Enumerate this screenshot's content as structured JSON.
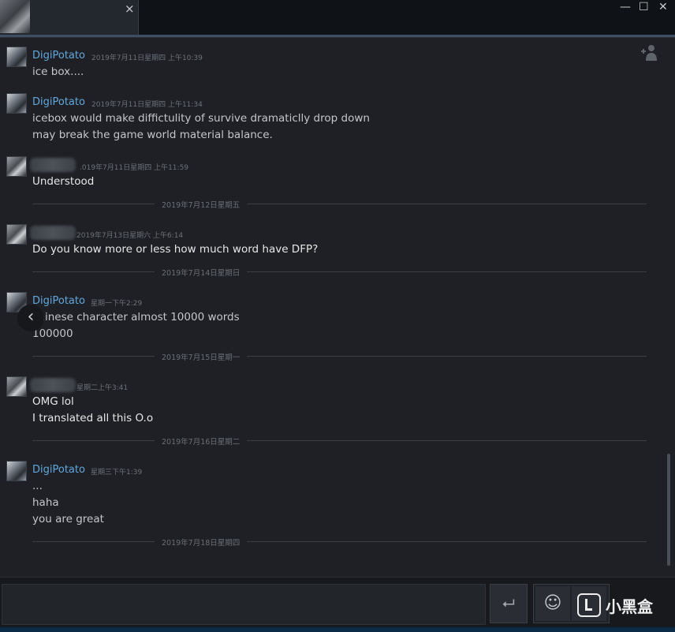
{
  "window": {
    "tab_close": "×",
    "minimize": "—",
    "maximize": "☐",
    "close": "✕"
  },
  "icons": {
    "invite": "invite-friend-icon",
    "back": "chevron-left-icon",
    "send": "enter-icon",
    "emoji": "smiley-icon"
  },
  "messages": [
    {
      "sender": "DigiPotato",
      "time": "2019年7月11日星期四 上午10:39",
      "lines": [
        "ice box...."
      ]
    },
    {
      "sender": "DigiPotato",
      "time": "2019年7月11日星期四 上午11:34",
      "lines": [
        "icebox would make diffictulity of survive dramaticlly drop down",
        "may break the game world material balance."
      ]
    },
    {
      "sender": "",
      "time": ".019年7月11日星期四 上午11:59",
      "lines": [
        "Understood"
      ]
    },
    {
      "sender": "",
      "time": "2019年7月13日星期六 上午6:14",
      "lines": [
        "Do you know more or less how much word have DFP?"
      ]
    },
    {
      "sender": "DigiPotato",
      "time": "星期一下午2:29",
      "lines": [
        "chinese character almost 10000 words",
        "100000"
      ]
    },
    {
      "sender": "",
      "time": "星期二上午3:41",
      "lines": [
        "OMG lol",
        "I translated all this O.o"
      ]
    },
    {
      "sender": "DigiPotato",
      "time": "星期三下午1:39",
      "lines": [
        "...",
        "haha",
        "you are great"
      ]
    }
  ],
  "dividers": [
    "2019年7月12日星期五",
    "2019年7月14日星期日",
    "2019年7月15日星期一",
    "2019年7月16日星期二",
    "2019年7月18日星期四"
  ],
  "input": {
    "placeholder": "",
    "send_symbol": "⮠",
    "emoji_symbol": "☺"
  },
  "back_symbol": "‹",
  "watermark": {
    "text": "小黑盒"
  }
}
